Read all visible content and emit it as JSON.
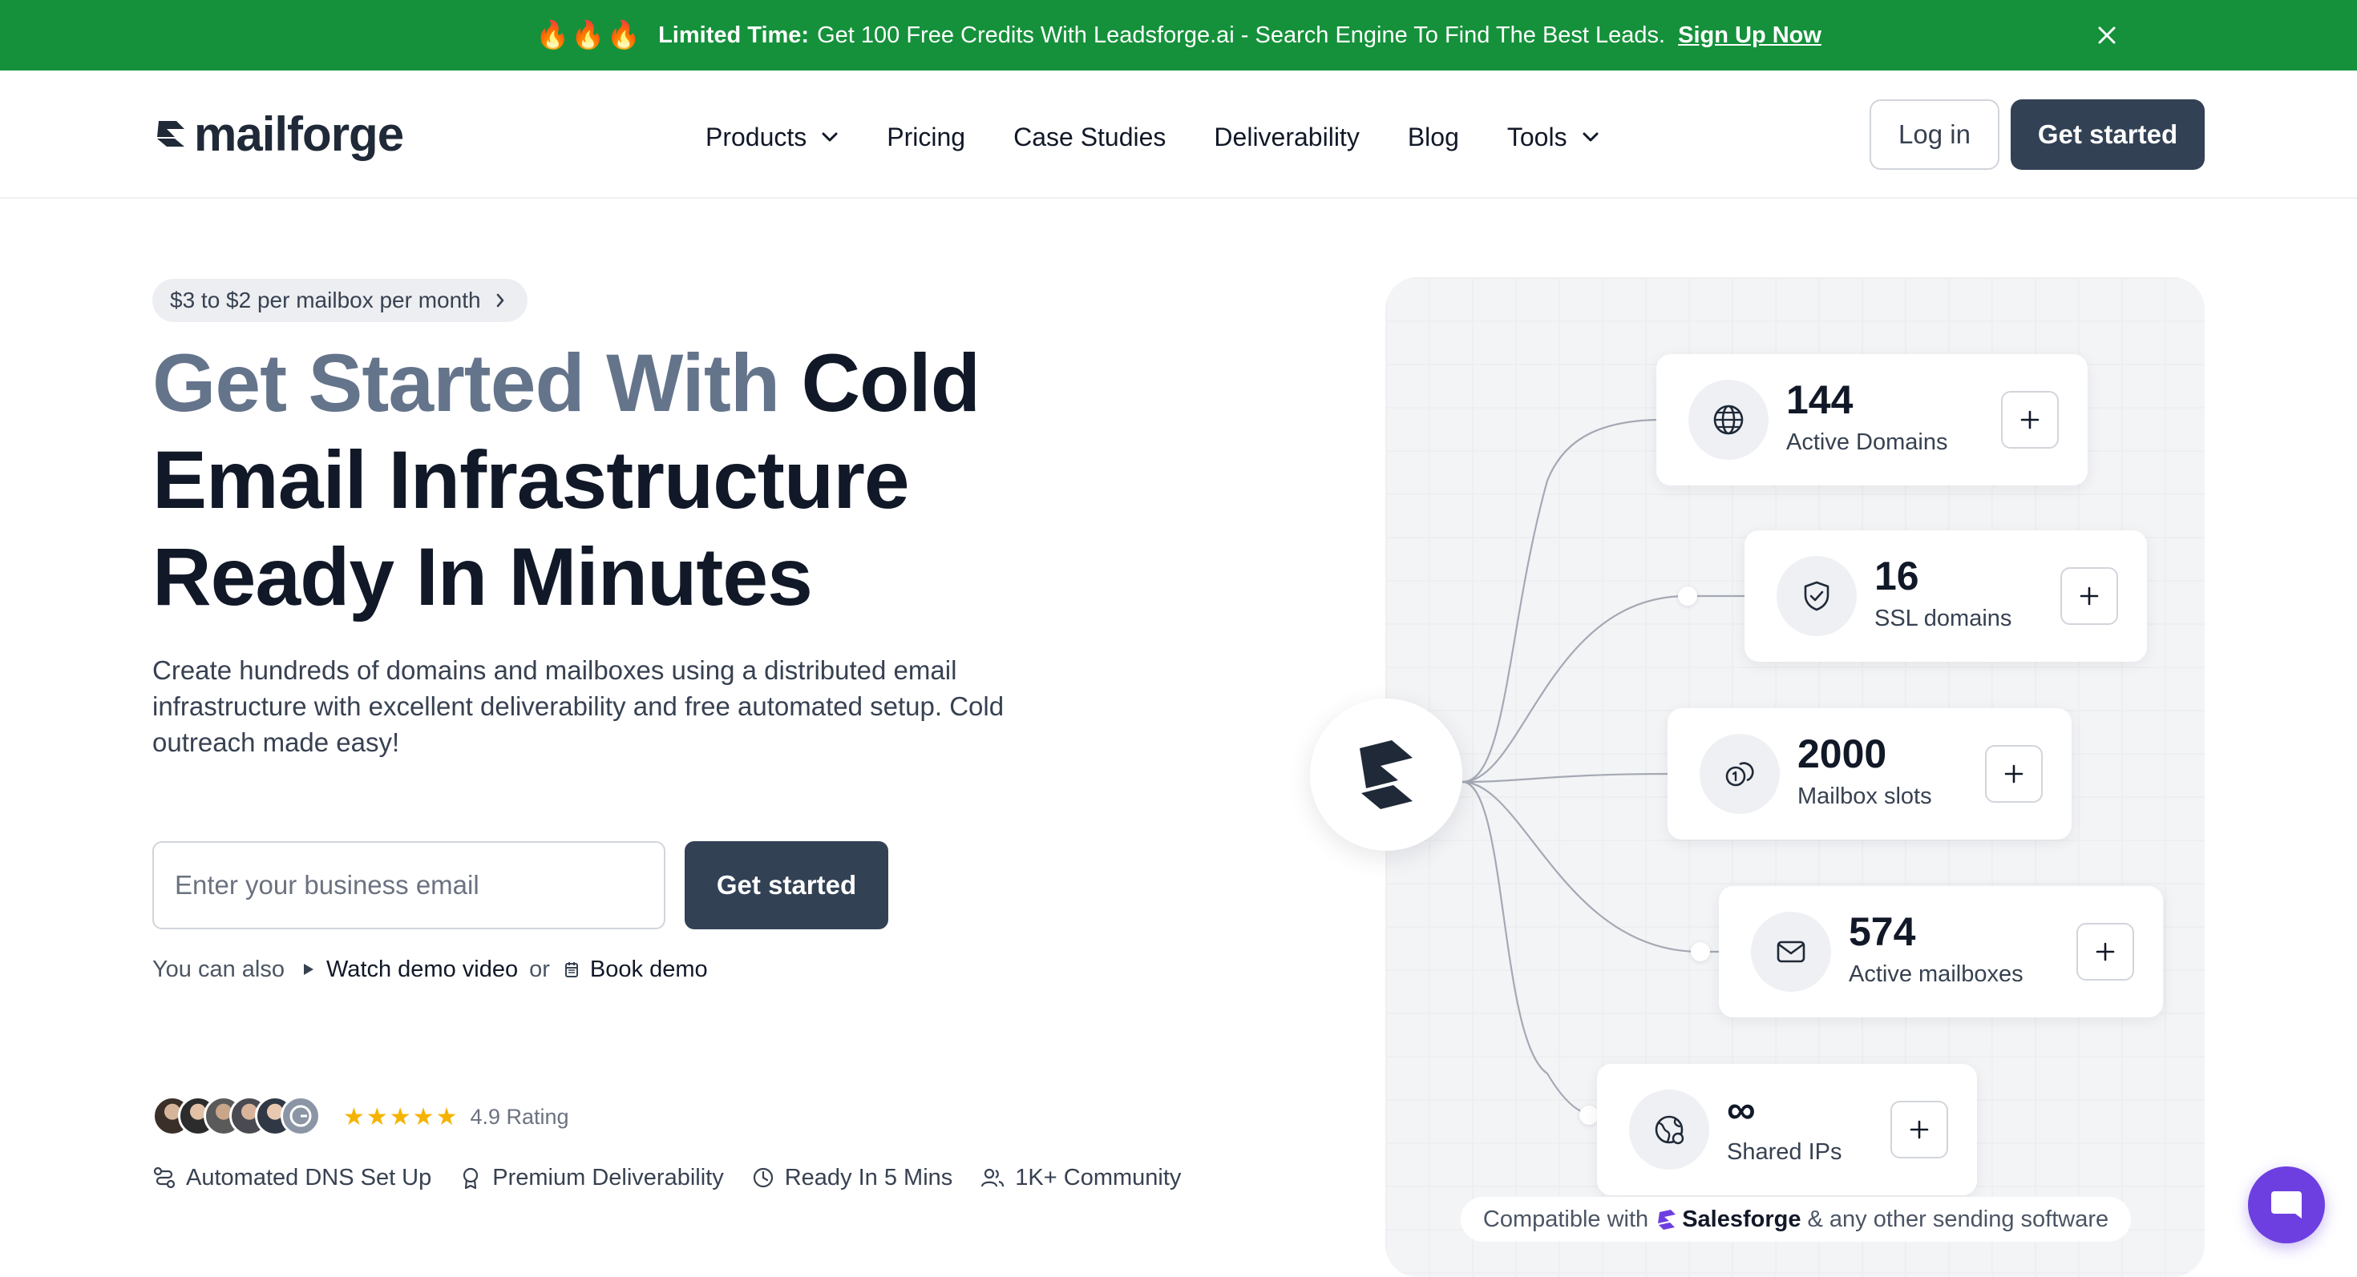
{
  "banner": {
    "fire_icons": [
      "🔥",
      "🔥",
      "🔥"
    ],
    "lead": "Limited Time:",
    "text": "Get 100 Free Credits With Leadsforge.ai - Search Engine To Find The Best Leads.",
    "link": "Sign Up Now",
    "bg_color": "#15913b",
    "close_icon": "close-icon"
  },
  "header": {
    "logo_text": "mailforge",
    "nav": {
      "products": "Products",
      "pricing": "Pricing",
      "case_studies": "Case Studies",
      "deliverability": "Deliverability",
      "blog": "Blog",
      "tools": "Tools"
    },
    "login": "Log in",
    "get_started": "Get started"
  },
  "hero": {
    "pill": "$3 to $2 per mailbox per month",
    "title_muted": "Get Started With",
    "title_rest": "Cold Email Infrastructure Ready In Minutes",
    "subtitle": "Create hundreds of domains and mailboxes using a distributed email infrastructure with excellent deliverability and free automated setup. Cold outreach made easy!",
    "email_placeholder": "Enter your business email",
    "cta": "Get started",
    "also_prefix": "You can also",
    "watch_demo": "Watch demo video",
    "or": "or",
    "book_demo": "Book demo",
    "stars": "★★★★★",
    "rating": "4.9 Rating",
    "features": {
      "dns": "Automated DNS Set Up",
      "deliverability": "Premium Deliverability",
      "ready": "Ready In 5 Mins",
      "community": "1K+ Community"
    }
  },
  "stats": [
    {
      "value": "144",
      "label": "Active Domains",
      "icon": "globe-icon"
    },
    {
      "value": "16",
      "label": "SSL domains",
      "icon": "shield-check-icon"
    },
    {
      "value": "2000",
      "label": "Mailbox slots",
      "icon": "coins-icon"
    },
    {
      "value": "574",
      "label": "Active mailboxes",
      "icon": "mail-icon"
    },
    {
      "value": "∞",
      "label": "Shared IPs",
      "icon": "network-globe-icon"
    }
  ],
  "compat": {
    "prefix": "Compatible with",
    "brand": "Salesforge",
    "suffix": "& any other sending software"
  },
  "colors": {
    "accent_dark": "#334155",
    "heading_muted": "#64748b",
    "chat_purple": "#6d3fe0",
    "star_yellow": "#f5b301"
  }
}
